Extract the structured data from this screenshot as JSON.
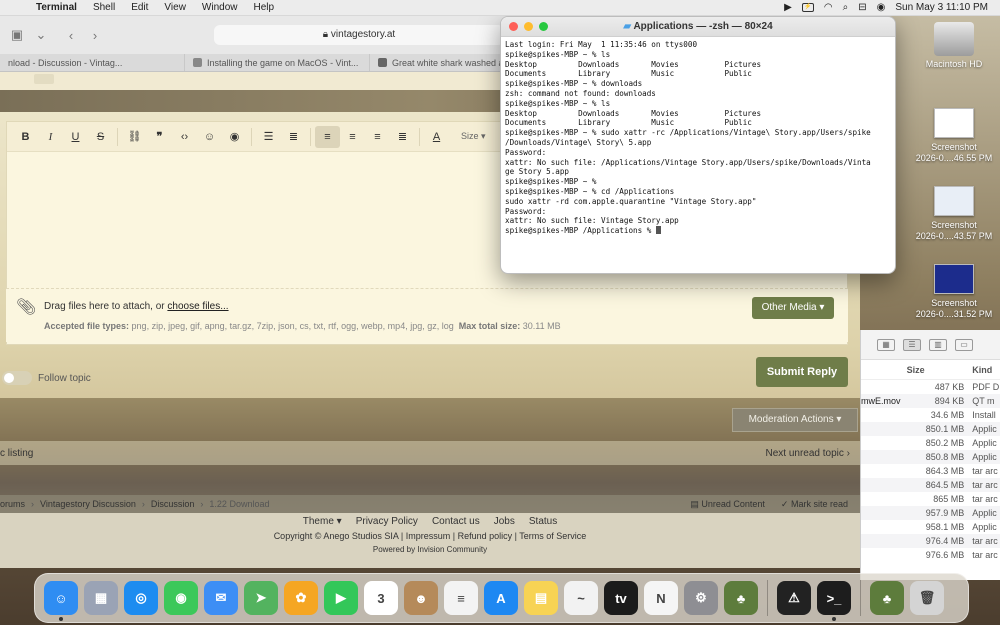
{
  "menubar": {
    "apple": "",
    "items": [
      "Terminal",
      "Shell",
      "Edit",
      "View",
      "Window",
      "Help"
    ],
    "clock": "Sun May 3  11:10 PM"
  },
  "desktop": {
    "hdd_label": "Macintosh HD",
    "screenshots": [
      {
        "title": "Screenshot",
        "subtitle": "2026-0....46.55 PM"
      },
      {
        "title": "Screenshot",
        "subtitle": "2026-0....43.57 PM"
      },
      {
        "title": "Screenshot",
        "subtitle": "2026-0....31.52 PM"
      }
    ]
  },
  "finder": {
    "headers": {
      "size": "Size",
      "kind": "Kind"
    },
    "rows": [
      {
        "name": "",
        "size": "487 KB",
        "kind": "PDF D"
      },
      {
        "name": "mwE.mov",
        "size": "894 KB",
        "kind": "QT m"
      },
      {
        "name": "",
        "size": "34.6 MB",
        "kind": "Install"
      },
      {
        "name": "",
        "size": "850.1 MB",
        "kind": "Applic"
      },
      {
        "name": "",
        "size": "850.2 MB",
        "kind": "Applic"
      },
      {
        "name": "",
        "size": "850.8 MB",
        "kind": "Applic"
      },
      {
        "name": "",
        "size": "864.3 MB",
        "kind": "tar arc"
      },
      {
        "name": "",
        "size": "864.5 MB",
        "kind": "tar arc"
      },
      {
        "name": "",
        "size": "865 MB",
        "kind": "tar arc"
      },
      {
        "name": "",
        "size": "957.9 MB",
        "kind": "Applic"
      },
      {
        "name": "",
        "size": "958.1 MB",
        "kind": "Applic"
      },
      {
        "name": "",
        "size": "976.4 MB",
        "kind": "tar arc"
      },
      {
        "name": "",
        "size": "976.6 MB",
        "kind": "tar arc"
      }
    ]
  },
  "browser": {
    "url": "vintagestory.at",
    "tabs": [
      "nload - Discussion - Vintag...",
      "Installing the game on MacOS - Vint...",
      "Great white shark washed ashore -..."
    ],
    "editor": {
      "size_label": "Size",
      "drag_text": "Drag files here to attach, or ",
      "choose_files": "choose files...",
      "accepted_label": "Accepted file types:",
      "accepted_types": "png, zip, jpeg, gif, apng, tar.gz, 7zip, json, cs, txt, rtf, ogg, webp, mp4, jpg, gz, log",
      "max_label": "Max total size:",
      "max_size": "30.11 MB",
      "other_media": "Other Media ▾"
    },
    "follow_topic": "Follow topic",
    "submit_reply": "Submit Reply",
    "moderation_actions": "Moderation Actions ▾",
    "topic_listing": "c listing",
    "next_unread": "Next unread topic",
    "breadcrumbs": [
      "orums",
      "Vintagestory Discussion",
      "Discussion",
      "1.22 Download"
    ],
    "unread_content": "Unread Content",
    "mark_site_read": "Mark site read",
    "footer_links": [
      "Theme ▾",
      "Privacy Policy",
      "Contact us",
      "Jobs",
      "Status"
    ],
    "copyright": "Copyright © Anego Studios SIA | Impressum | Refund policy | Terms of Service",
    "powered": "Powered by Invision Community"
  },
  "terminal": {
    "title": "Applications — -zsh — 80×24",
    "lines": [
      "Last login: Fri May  1 11:35:46 on ttys000",
      "spike@spikes-MBP ~ % ls",
      "Desktop         Downloads       Movies          Pictures",
      "Documents       Library         Music           Public",
      "spike@spikes-MBP ~ % downloads",
      "zsh: command not found: downloads",
      "spike@spikes-MBP ~ % ls",
      "Desktop         Downloads       Movies          Pictures",
      "Documents       Library         Music           Public",
      "spike@spikes-MBP ~ % sudo xattr -rc /Applications/Vintage\\ Story.app/Users/spike",
      "/Downloads/Vintage\\ Story\\ 5.app",
      "Password:",
      "xattr: No such file: /Applications/Vintage Story.app/Users/spike/Downloads/Vinta",
      "ge Story 5.app",
      "spike@spikes-MBP ~ %",
      "spike@spikes-MBP ~ % cd /Applications",
      "sudo xattr -rd com.apple.quarantine \"Vintage Story.app\"",
      "Password:",
      "xattr: No such file: Vintage Story.app",
      "spike@spikes-MBP /Applications % "
    ]
  },
  "dock": {
    "items": [
      {
        "name": "finder-icon",
        "color": "#2f8df2",
        "glyph": "☺",
        "running": true
      },
      {
        "name": "launchpad-icon",
        "color": "#9aa3b5",
        "glyph": "▦",
        "running": false
      },
      {
        "name": "safari-icon",
        "color": "#1d8cf0",
        "glyph": "◎",
        "running": false
      },
      {
        "name": "messages-icon",
        "color": "#3cc85a",
        "glyph": "◉",
        "running": false
      },
      {
        "name": "mail-icon",
        "color": "#3d8ef5",
        "glyph": "✉",
        "running": false
      },
      {
        "name": "maps-icon",
        "color": "#53b35f",
        "glyph": "➤",
        "running": false
      },
      {
        "name": "photos-icon",
        "color": "#f5a623",
        "glyph": "✿",
        "running": false
      },
      {
        "name": "facetime-icon",
        "color": "#33c759",
        "glyph": "▶",
        "running": false
      },
      {
        "name": "calendar-icon",
        "color": "#ffffff",
        "glyph": "3",
        "running": false
      },
      {
        "name": "contacts-icon",
        "color": "#b58a5a",
        "glyph": "☻",
        "running": false
      },
      {
        "name": "reminders-icon",
        "color": "#f3f3f3",
        "glyph": "≡",
        "running": false
      },
      {
        "name": "app-store-icon",
        "color": "#1e88f2",
        "glyph": "A",
        "running": false
      },
      {
        "name": "notes-icon",
        "color": "#f7d354",
        "glyph": "▤",
        "running": false
      },
      {
        "name": "freeform-icon",
        "color": "#f2f2f2",
        "glyph": "~",
        "running": false
      },
      {
        "name": "tv-icon",
        "color": "#1b1b1b",
        "glyph": "tv",
        "running": false
      },
      {
        "name": "news-icon",
        "color": "#f5f5f5",
        "glyph": "N",
        "running": false
      },
      {
        "name": "system-settings-icon",
        "color": "#8e8e93",
        "glyph": "⚙",
        "running": false
      },
      {
        "name": "vintage-story-icon",
        "color": "#5d7c3c",
        "glyph": "♣",
        "running": false
      }
    ],
    "recent": [
      {
        "name": "console-icon",
        "color": "#222222",
        "glyph": "⚠",
        "running": false
      },
      {
        "name": "terminal-icon",
        "color": "#1d1d1d",
        "glyph": ">_",
        "running": true
      }
    ],
    "docs": [
      {
        "name": "vintage-story-doc-icon",
        "color": "#5d7c3c",
        "glyph": "♣",
        "running": false
      },
      {
        "name": "trash-icon",
        "color": "#d4d4d4",
        "glyph": "🗑",
        "running": false
      }
    ]
  }
}
